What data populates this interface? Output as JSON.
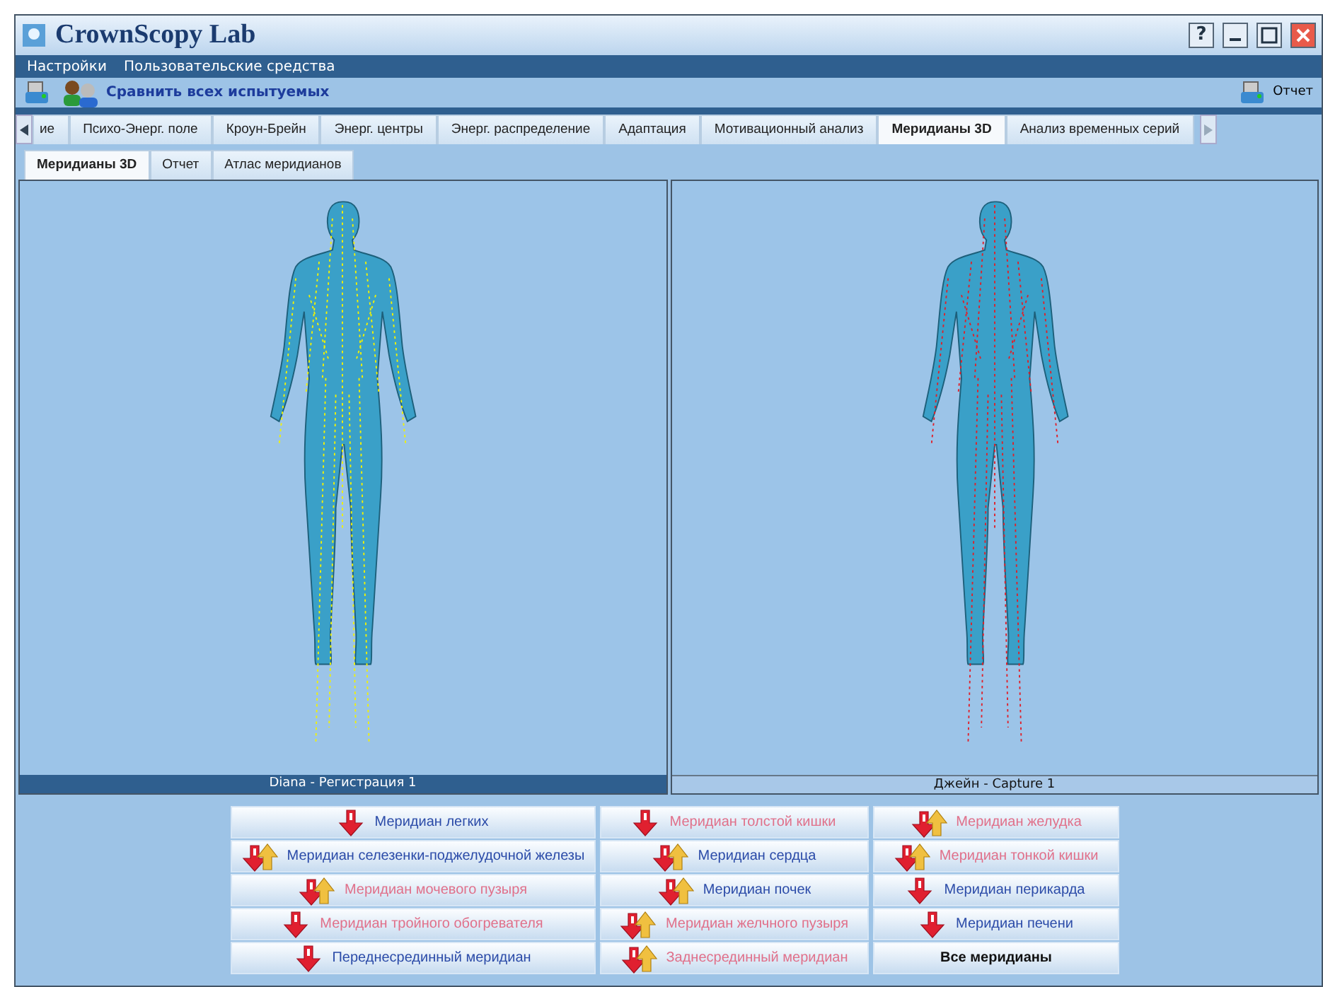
{
  "window": {
    "title": "CrownScopy Lab",
    "help": "?"
  },
  "menu": [
    "Настройки",
    "Пользовательские средства"
  ],
  "toolbar": {
    "compare": "Сравнить всех испытуемых",
    "report": "Отчет"
  },
  "tabs": [
    {
      "label": "ие",
      "selected": false
    },
    {
      "label": "Психо-Энерг. поле",
      "selected": false
    },
    {
      "label": "Кроун-Брейн",
      "selected": false
    },
    {
      "label": "Энерг. центры",
      "selected": false
    },
    {
      "label": "Энерг. распределение",
      "selected": false
    },
    {
      "label": "Адаптация",
      "selected": false
    },
    {
      "label": "Мотивационный анализ",
      "selected": false
    },
    {
      "label": "Меридианы 3D",
      "selected": true
    },
    {
      "label": "Анализ временных серий",
      "selected": false
    }
  ],
  "subtabs": [
    {
      "label": "Меридианы 3D",
      "selected": true
    },
    {
      "label": "Отчет",
      "selected": false
    },
    {
      "label": "Атлас меридианов",
      "selected": false
    }
  ],
  "viewports": [
    {
      "caption": "Diana  - Регистрация 1",
      "selected": true,
      "color": "#f2f200"
    },
    {
      "caption": "Джейн  - Capture 1",
      "selected": false,
      "color": "#e0202a"
    }
  ],
  "meridians": [
    {
      "label": "Меридиан легких",
      "kind": "down",
      "color": "#2b4ba8"
    },
    {
      "label": "Меридиан толстой кишки",
      "kind": "down",
      "color": "#e0708a"
    },
    {
      "label": "Меридиан желудка",
      "kind": "downup",
      "color": "#e0708a"
    },
    {
      "label": "Меридиан селезенки-поджелудочной железы",
      "kind": "downup",
      "color": "#2b4ba8"
    },
    {
      "label": "Меридиан сердца",
      "kind": "downup",
      "color": "#2b4ba8"
    },
    {
      "label": "Меридиан тонкой кишки",
      "kind": "downup",
      "color": "#e0708a"
    },
    {
      "label": "Меридиан мочевого пузыря",
      "kind": "downup",
      "color": "#e0708a"
    },
    {
      "label": "Меридиан почек",
      "kind": "downup",
      "color": "#2b4ba8"
    },
    {
      "label": "Меридиан перикарда",
      "kind": "down",
      "color": "#2b4ba8"
    },
    {
      "label": "Меридиан тройного обогревателя",
      "kind": "down",
      "color": "#e0708a"
    },
    {
      "label": "Меридиан желчного пузыря",
      "kind": "downup",
      "color": "#e0708a"
    },
    {
      "label": "Меридиан печени",
      "kind": "down",
      "color": "#2b4ba8"
    },
    {
      "label": "Переднесрединный меридиан",
      "kind": "down",
      "color": "#2b4ba8"
    },
    {
      "label": "Заднесрединный меридиан",
      "kind": "downup",
      "color": "#e0708a"
    },
    {
      "label": "Все меридианы",
      "kind": "all",
      "color": "#111111"
    }
  ]
}
